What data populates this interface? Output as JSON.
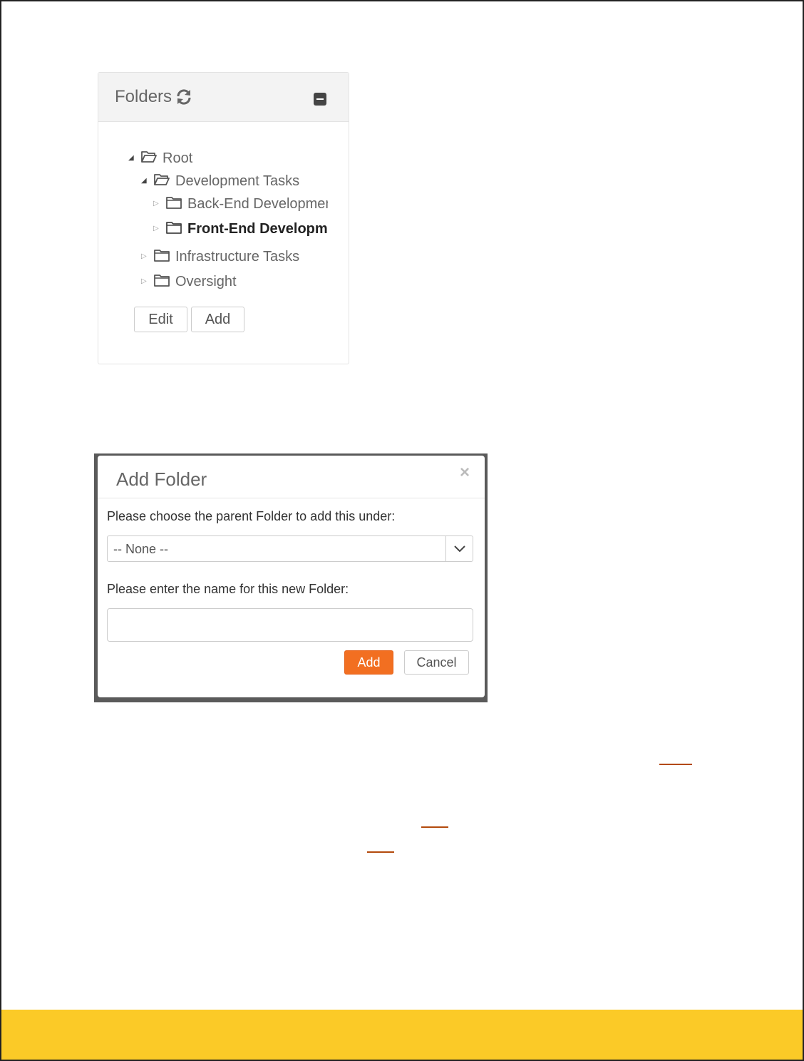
{
  "folders_panel": {
    "title": "Folders",
    "refresh_icon": "refresh-icon",
    "collapse_icon": "collapse-minus-icon",
    "tree": [
      {
        "label": "Root",
        "expanded": true,
        "bold": false
      },
      {
        "label": "Development Tasks",
        "expanded": true,
        "bold": false
      },
      {
        "label": "Back-End Development",
        "expanded": false,
        "bold": false
      },
      {
        "label": "Front-End Development",
        "expanded": false,
        "bold": true
      },
      {
        "label": "Infrastructure Tasks",
        "expanded": false,
        "bold": false
      },
      {
        "label": "Oversight",
        "expanded": false,
        "bold": false
      }
    ],
    "edit_label": "Edit",
    "add_label": "Add"
  },
  "add_folder_modal": {
    "title": "Add Folder",
    "close_glyph": "×",
    "parent_label": "Please choose the parent Folder to add this under:",
    "parent_selected": "-- None --",
    "name_label": "Please enter the name for this new Folder:",
    "name_value": "",
    "add_label": "Add",
    "cancel_label": "Cancel"
  },
  "colors": {
    "primary_button": "#f26f21",
    "footer_bar": "#fbca27",
    "link_underline": "#b34a0c"
  }
}
